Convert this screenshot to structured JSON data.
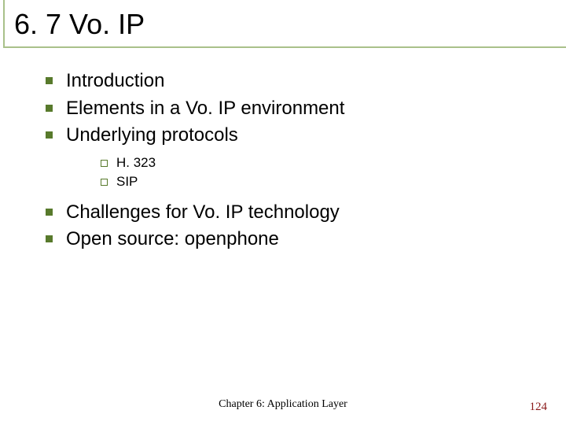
{
  "title": "6. 7 Vo. IP",
  "bullets1": {
    "items": [
      "Introduction",
      "Elements in a Vo. IP environment",
      "Underlying protocols"
    ],
    "sub": [
      "H. 323",
      "SIP"
    ]
  },
  "bullets2": {
    "items": [
      "Challenges for Vo. IP technology",
      "Open source: openphone"
    ]
  },
  "footer": {
    "center": "Chapter 6: Application Layer",
    "page": "124"
  }
}
